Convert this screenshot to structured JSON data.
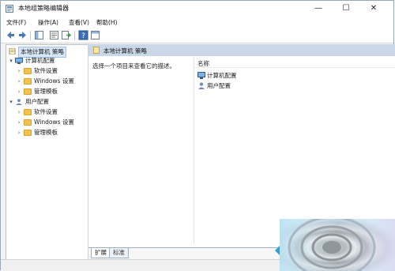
{
  "window": {
    "title": "本地组策略编辑器",
    "controls": {
      "minimize": "—",
      "maximize": "☐",
      "close": "✕"
    }
  },
  "menu": {
    "items": [
      {
        "label": "文件(F)"
      },
      {
        "label": "操作(A)"
      },
      {
        "label": "查看(V)"
      },
      {
        "label": "帮助(H)"
      }
    ]
  },
  "toolbar": {
    "buttons": [
      "back-arrow-icon",
      "forward-arrow-icon",
      "show-tree-icon",
      "properties-icon",
      "export-list-icon",
      "help-icon",
      "extended-view-icon"
    ]
  },
  "tree": {
    "root": "本地计算机 策略",
    "computer_config": "计算机配置",
    "user_config": "用户配置",
    "software_settings": "软件设置",
    "windows_settings": "Windows 设置",
    "admin_templates": "管理模板",
    "expanded_glyph": "▾",
    "collapsed_glyph": "›"
  },
  "right_pane": {
    "header_title": "本地计算机 策略",
    "description": "选择一个项目来查看它的描述。",
    "column_name": "名称",
    "items": [
      {
        "label": "计算机配置"
      },
      {
        "label": "用户配置"
      }
    ]
  },
  "tabs": [
    {
      "label": "扩展"
    },
    {
      "label": "标准"
    }
  ],
  "colors": {
    "header_bg": "#c9d7e8",
    "selection": "#d7e6f7",
    "folder": "#f2c14e",
    "accent": "#2a7fd4"
  }
}
